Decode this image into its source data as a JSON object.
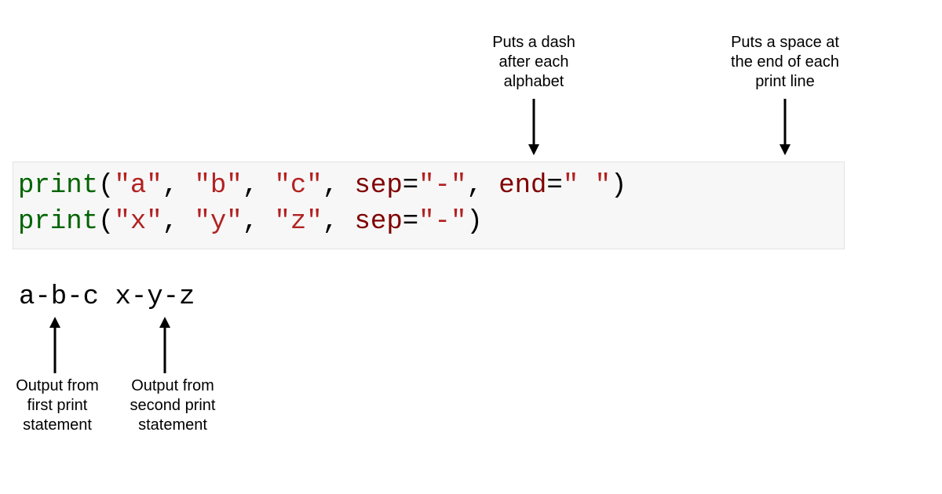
{
  "annotations": {
    "sep_label": "Puts a dash\nafter each\nalphabet",
    "end_label": "Puts a space at\nthe end of each\nprint line",
    "out1_label": "Output from\nfirst print\nstatement",
    "out2_label": "Output from\nsecond print\nstatement"
  },
  "code": {
    "line1": {
      "fn": "print",
      "open": "(",
      "arg_a": "\"a\"",
      "sep1": ", ",
      "arg_b": "\"b\"",
      "sep2": ", ",
      "arg_c": "\"c\"",
      "sep3": ", ",
      "kw_sep": "sep",
      "eq1": "=",
      "sep_val": "\"-\"",
      "sep4": ", ",
      "kw_end": "end",
      "eq2": "=",
      "end_val": "\" \"",
      "close": ")"
    },
    "line2": {
      "fn": "print",
      "open": "(",
      "arg_x": "\"x\"",
      "sep1": ", ",
      "arg_y": "\"y\"",
      "sep2": ", ",
      "arg_z": "\"z\"",
      "sep3": ", ",
      "kw_sep": "sep",
      "eq1": "=",
      "sep_val": "\"-\"",
      "close": ")"
    }
  },
  "output": {
    "part1": "a-b-c",
    "space": " ",
    "part2": "x-y-z"
  }
}
